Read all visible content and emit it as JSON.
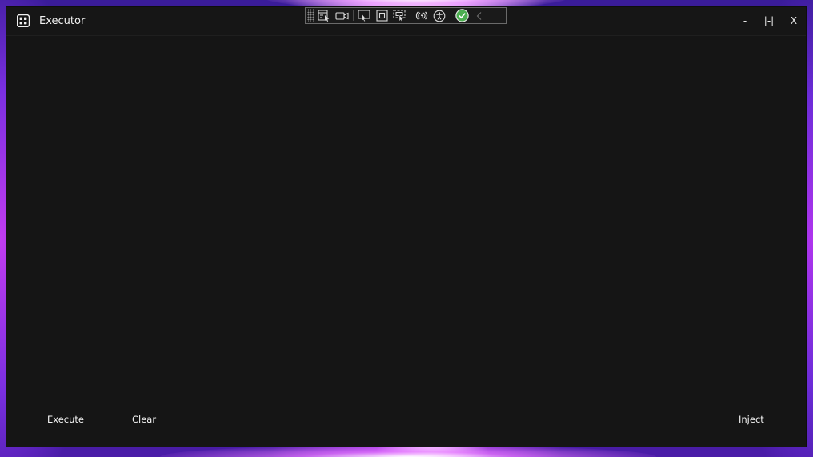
{
  "window": {
    "title": "Executor",
    "controls": {
      "minimize_label": "-",
      "maximize_label": "|-|",
      "close_label": "X"
    }
  },
  "debug_toolbar": {
    "icons": [
      "select-element-icon",
      "record-video-icon",
      "pointer-select-icon",
      "focus-box-icon",
      "display-layout-icon",
      "hot-reload-icon",
      "accessibility-icon",
      "status-check-icon",
      "collapse-chevron-icon"
    ]
  },
  "actions": {
    "execute_label": "Execute",
    "clear_label": "Clear",
    "inject_label": "Inject"
  },
  "colors": {
    "window_background": "#151515",
    "text": "#f2f2f2",
    "status_ok": "#4caf50"
  }
}
